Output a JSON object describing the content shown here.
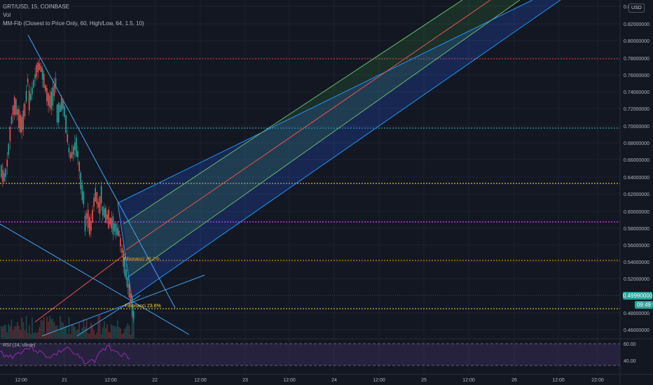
{
  "header": {
    "symbol_line": "GRT/USD, 15, COINBASE",
    "vol_label": "Vol",
    "indicator_line": "MM-Fib (Closest to Price Only, 60, High/Low, 64, 1.5, 10)"
  },
  "currency_badge": "USD",
  "y_axis": {
    "labels": [
      "0.8",
      "0.82000000",
      "0.80000000",
      "0.78000000",
      "0.76000000",
      "0.74000000",
      "0.72000000",
      "0.70000000",
      "0.68000000",
      "0.66000000",
      "0.64000000",
      "0.62000000",
      "0.60000000",
      "0.58000000",
      "0.56000000",
      "0.54000000",
      "0.52000000",
      "0.48000000",
      "0.46000000"
    ]
  },
  "current_price": "0.49990000",
  "countdown": "09:49",
  "x_axis": {
    "labels": [
      "12:00",
      "21",
      "12:00",
      "22",
      "12:00",
      "23",
      "12:00",
      "24",
      "12:00",
      "25",
      "12:00",
      "26",
      "12:00",
      "22:00"
    ]
  },
  "fib_labels": {
    "fib_382": "Fibonacci 38.2%",
    "fib_236": "Fibonacci 23.6%"
  },
  "rsi": {
    "label": "RSI (14, close)",
    "upper": "60.00",
    "lower": "40.00"
  },
  "colors": {
    "background": "#131722",
    "up_candle": "#26a69a",
    "down_candle": "#ef5350",
    "channel_blue": "#2196f3",
    "channel_green": "#4caf50",
    "price_tag": "#26a69a",
    "rsi_line": "#9c27b0",
    "level_red": "#e53935",
    "level_cyan": "#26c6da",
    "level_yellow": "#ffeb3b",
    "level_magenta": "#e040fb",
    "level_orange": "#ff9800",
    "level_yellow2": "#fdd835"
  }
}
